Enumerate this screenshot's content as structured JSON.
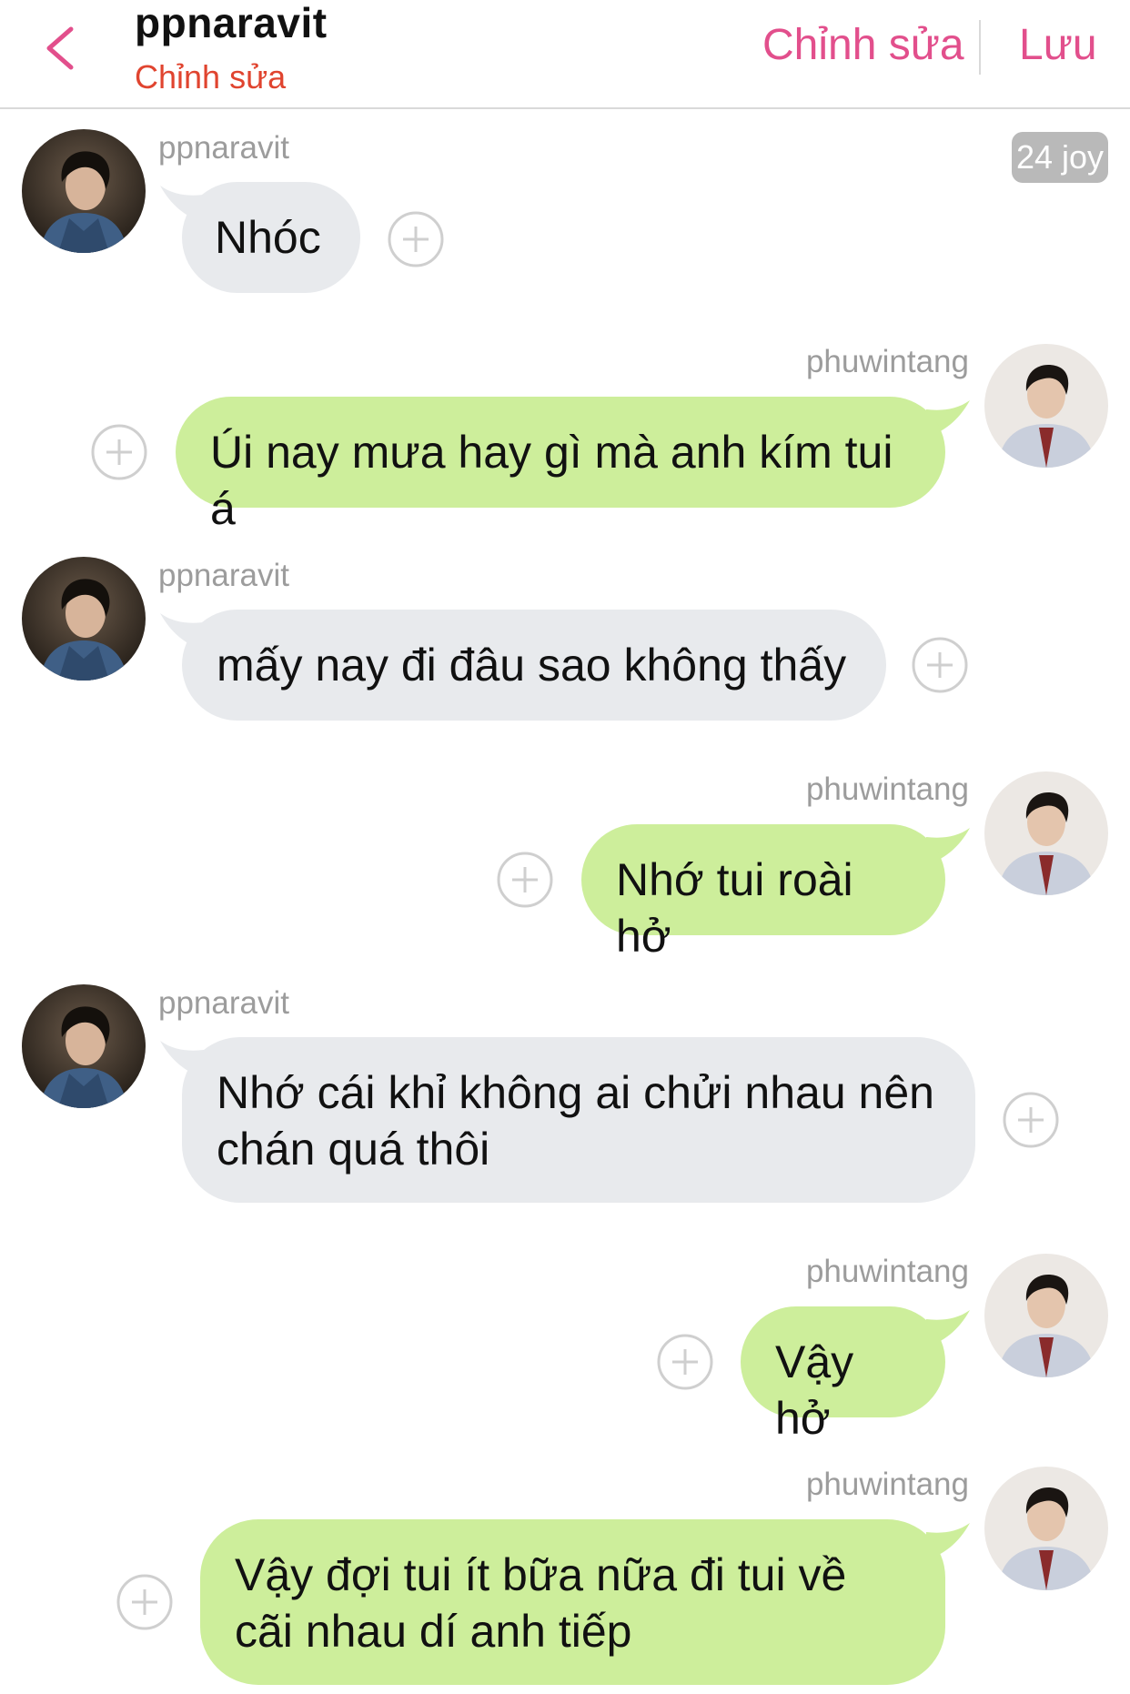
{
  "header": {
    "back_icon": "chevron-left-icon",
    "title": "ppnaravit",
    "subtitle": "Chỉnh sửa",
    "edit_label": "Chỉnh sửa",
    "save_label": "Lưu",
    "accent_color": "#e24f8c",
    "subtitle_color": "#e0442f"
  },
  "badge": "24 joy",
  "messages": [
    {
      "sender": "ppnaravit",
      "side": "left",
      "text": "Nhóc"
    },
    {
      "sender": "phuwintang",
      "side": "right",
      "text": "Úi nay mưa hay gì mà anh kím tui á"
    },
    {
      "sender": "ppnaravit",
      "side": "left",
      "text": "mấy nay đi đâu sao không thấy"
    },
    {
      "sender": "phuwintang",
      "side": "right",
      "text": "Nhớ tui roài hở"
    },
    {
      "sender": "ppnaravit",
      "side": "left",
      "text": "Nhớ cái khỉ không ai chửi nhau nên chán quá thôi"
    },
    {
      "sender": "phuwintang",
      "side": "right",
      "text": "Vậy hở"
    },
    {
      "sender": "phuwintang",
      "side": "right",
      "text": "Vậy đợi tui ít bữa nữa đi tui về cãi nhau dí anh tiếp"
    }
  ],
  "colors": {
    "left_bubble": "#e8eaed",
    "right_bubble": "#cdee9b",
    "sender_name": "#9c9c9c"
  },
  "icons": {
    "add_reaction": "plus-circle-icon",
    "avatar": "avatar"
  }
}
